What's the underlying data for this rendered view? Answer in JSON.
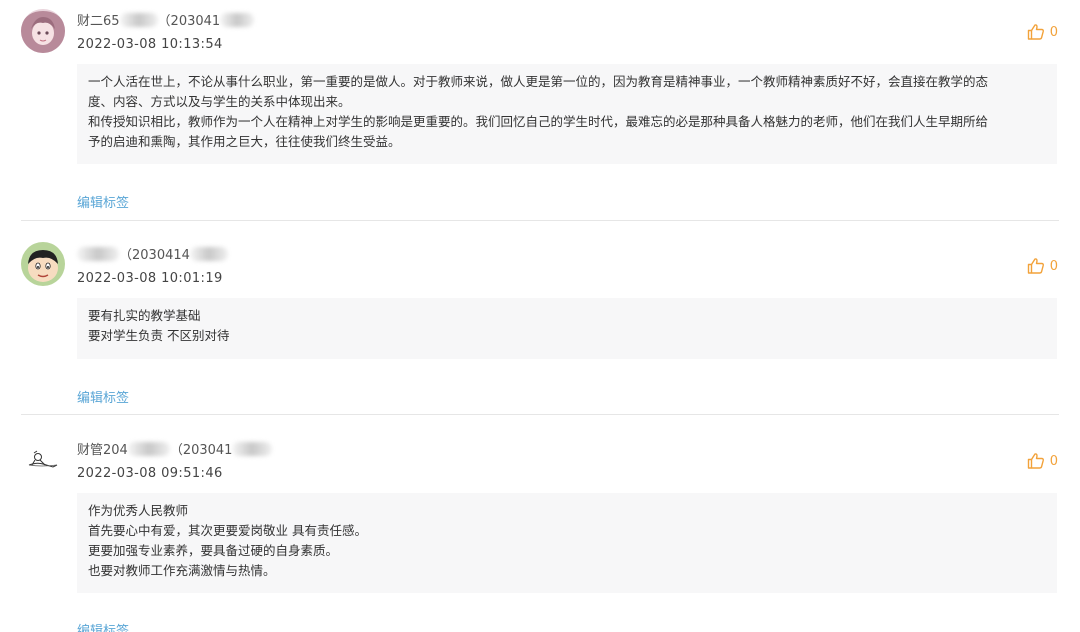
{
  "comments": [
    {
      "user_prefix": "财二65",
      "user_suffix": "（203041",
      "timestamp": "2022-03-08 10:13:54",
      "like_count": "0",
      "content": [
        "一个人活在世上，不论从事什么职业，第一重要的是做人。对于教师来说，做人更是第一位的，因为教育是精神事业，一个教师精神素质好不好，会直接在教学的态",
        "度、内容、方式以及与学生的关系中体现出来。",
        "和传授知识相比，教师作为一个人在精神上对学生的影响是更重要的。我们回忆自己的学生时代，最难忘的必是那种具备人格魅力的老师，他们在我们人生早期所给",
        "予的启迪和熏陶，其作用之巨大，往往使我们终生受益。"
      ],
      "edit_label": "编辑标签"
    },
    {
      "user_prefix": "",
      "user_suffix": "（2030414",
      "timestamp": "2022-03-08 10:01:19",
      "like_count": "0",
      "content": [
        "要有扎实的教学基础",
        "要对学生负责 不区别对待"
      ],
      "edit_label": "编辑标签"
    },
    {
      "user_prefix": "财管204",
      "user_suffix": "（203041",
      "timestamp": "2022-03-08 09:51:46",
      "like_count": "0",
      "content": [
        "作为优秀人民教师",
        "首先要心中有爱，其次更要爱岗敬业 具有责任感。",
        "更要加强专业素养，要具备过硬的自身素质。",
        "也要对教师工作充满激情与热情。"
      ],
      "edit_label": "编辑标签"
    }
  ]
}
